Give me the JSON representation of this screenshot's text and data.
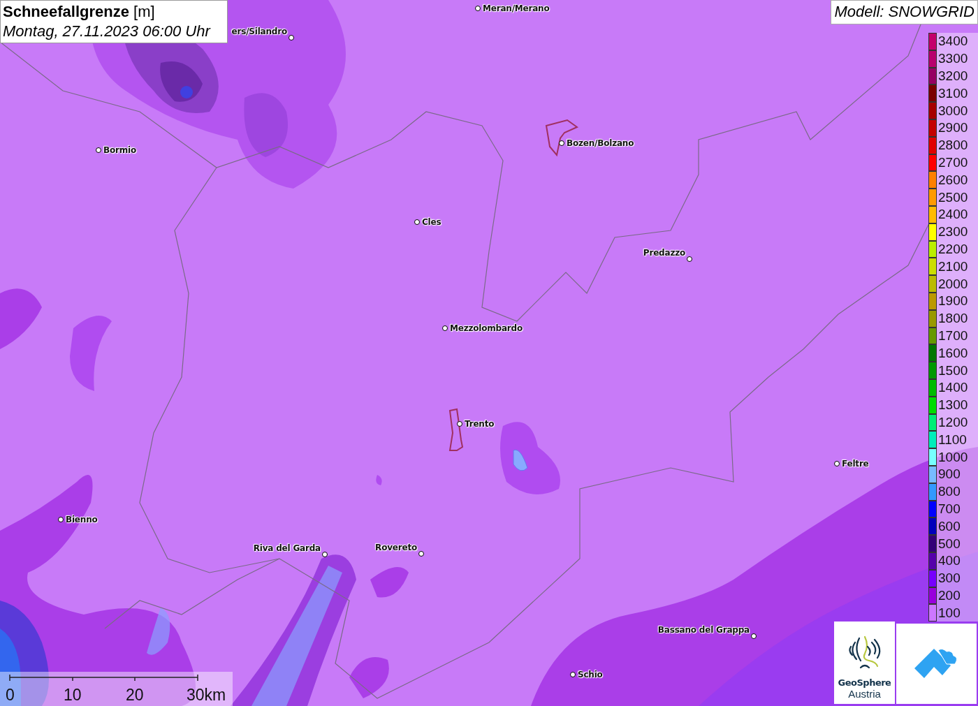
{
  "title": {
    "main": "Schneefallgrenze",
    "unit": "[m]",
    "date": "Montag, 27.11.2023 06:00 Uhr"
  },
  "model": "Modell: SNOWGRID",
  "cities": [
    {
      "name": "Meran/Merano"
    },
    {
      "name": "ers/Silandro"
    },
    {
      "name": "Bormio"
    },
    {
      "name": "Bozen/Bolzano"
    },
    {
      "name": "Cles"
    },
    {
      "name": "Predazzo"
    },
    {
      "name": "Mezzolombardo"
    },
    {
      "name": "Trento"
    },
    {
      "name": "Feltre"
    },
    {
      "name": "Bienno"
    },
    {
      "name": "Riva del Garda"
    },
    {
      "name": "Rovereto"
    },
    {
      "name": "Bassano del Grappa"
    },
    {
      "name": "Schio"
    }
  ],
  "legend": [
    {
      "label": "3400",
      "color": "#c4006c"
    },
    {
      "label": "3300",
      "color": "#b8006e"
    },
    {
      "label": "3200",
      "color": "#960064"
    },
    {
      "label": "3100",
      "color": "#7a0000"
    },
    {
      "label": "3000",
      "color": "#a60000"
    },
    {
      "label": "2900",
      "color": "#c40000"
    },
    {
      "label": "2800",
      "color": "#e00000"
    },
    {
      "label": "2700",
      "color": "#ff0000"
    },
    {
      "label": "2600",
      "color": "#ff8000"
    },
    {
      "label": "2500",
      "color": "#ff9a00"
    },
    {
      "label": "2400",
      "color": "#ffbb00"
    },
    {
      "label": "2300",
      "color": "#ffff00"
    },
    {
      "label": "2200",
      "color": "#bbee00"
    },
    {
      "label": "2100",
      "color": "#ccdd00"
    },
    {
      "label": "2000",
      "color": "#bbbb00"
    },
    {
      "label": "1900",
      "color": "#bb9900"
    },
    {
      "label": "1800",
      "color": "#999900"
    },
    {
      "label": "1700",
      "color": "#669900"
    },
    {
      "label": "1600",
      "color": "#007700"
    },
    {
      "label": "1500",
      "color": "#009900"
    },
    {
      "label": "1400",
      "color": "#00bb00"
    },
    {
      "label": "1300",
      "color": "#00dd00"
    },
    {
      "label": "1200",
      "color": "#00ee77"
    },
    {
      "label": "1100",
      "color": "#00eebb"
    },
    {
      "label": "1000",
      "color": "#77ffff"
    },
    {
      "label": "900",
      "color": "#77bbff"
    },
    {
      "label": "800",
      "color": "#3399ff"
    },
    {
      "label": "700",
      "color": "#0000ff"
    },
    {
      "label": "600",
      "color": "#0000bb"
    },
    {
      "label": "500",
      "color": "#330077"
    },
    {
      "label": "400",
      "color": "#5500aa"
    },
    {
      "label": "300",
      "color": "#7700ff"
    },
    {
      "label": "200",
      "color": "#9900dd"
    },
    {
      "label": "100",
      "color": "#cc77ff"
    }
  ],
  "scale_bar": {
    "labels": [
      "0",
      "10",
      "20",
      "30km"
    ]
  },
  "logos": {
    "geosphere": {
      "line1": "GeoSphere",
      "line2": "Austria"
    }
  }
}
